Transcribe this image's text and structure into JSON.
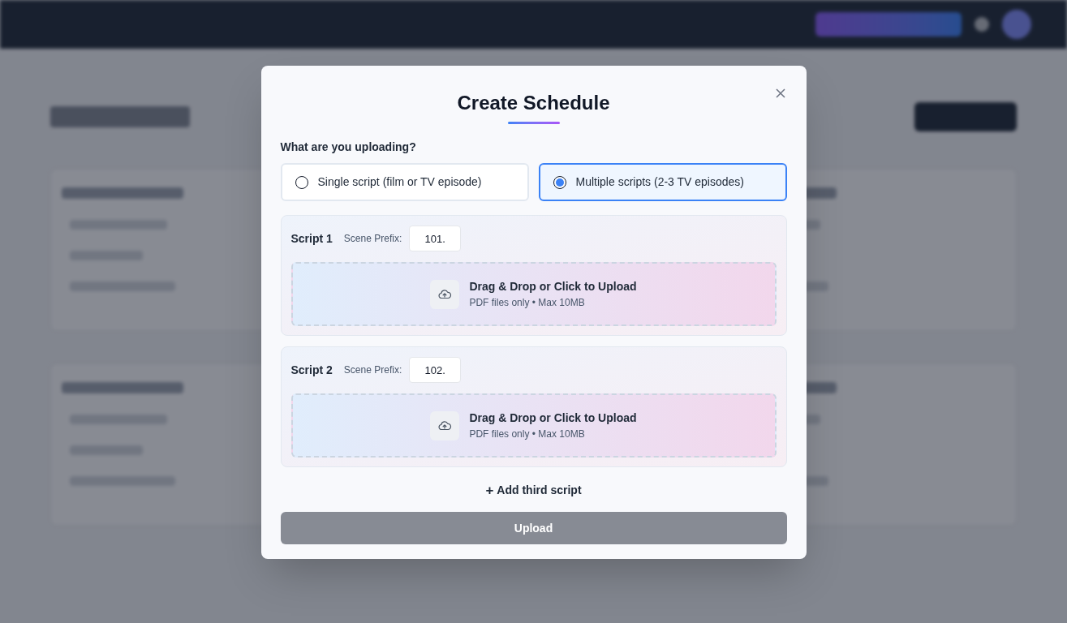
{
  "modal": {
    "title": "Create Schedule",
    "question": "What are you uploading?",
    "options": [
      {
        "label": "Single script (film or TV episode)",
        "selected": false
      },
      {
        "label": "Multiple scripts (2-3 TV episodes)",
        "selected": true
      }
    ],
    "scripts": [
      {
        "label": "Script 1",
        "prefix_label": "Scene Prefix:",
        "prefix": "101.",
        "upload_title": "Drag & Drop or Click to Upload",
        "upload_hint": "PDF files only • Max 10MB"
      },
      {
        "label": "Script 2",
        "prefix_label": "Scene Prefix:",
        "prefix": "102.",
        "upload_title": "Drag & Drop or Click to Upload",
        "upload_hint": "PDF files only • Max 10MB"
      }
    ],
    "add_icon": "+",
    "add_label": "Add third script",
    "submit": {
      "label": "Upload",
      "disabled": true
    }
  }
}
